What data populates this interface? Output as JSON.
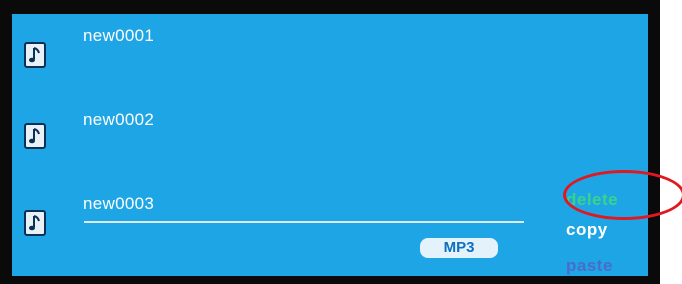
{
  "files": [
    {
      "name": "new0001",
      "icon": "music-note-icon"
    },
    {
      "name": "new0002",
      "icon": "music-note-icon"
    },
    {
      "name": "new0003",
      "icon": "music-note-icon"
    }
  ],
  "format_badge": "MP3",
  "menu": {
    "delete_label": "delete",
    "copy_label": "copy",
    "paste_label": "paste"
  },
  "colors": {
    "screen_bg": "#1ea5e6",
    "bezel": "#0a0a0a",
    "selected_menu": "#3ad389",
    "highlight_ring": "#e01820"
  }
}
